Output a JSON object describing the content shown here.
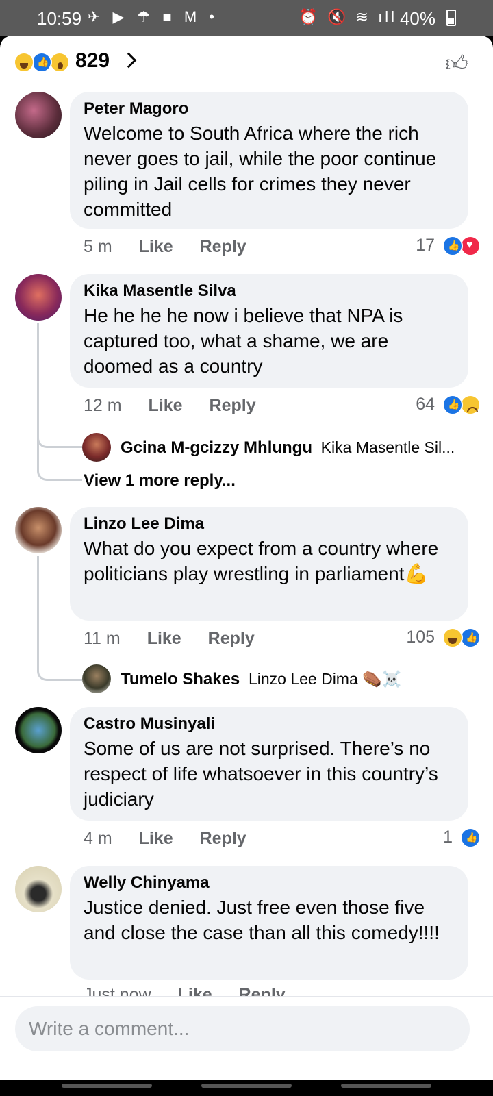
{
  "status_bar": {
    "time": "10:59",
    "left_icons": "✈ ▶ ☂ ■ M •",
    "right_icons": "⏰ 🔇 ≋ ıll",
    "battery": "40%"
  },
  "header": {
    "reaction_count": "829",
    "reactions": [
      "haha",
      "like",
      "wow"
    ],
    "like_icon": "thumbs-up-outline-icon"
  },
  "comments": [
    {
      "author": "Peter Magoro",
      "text": "Welcome to South Africa where the rich never goes to jail, while the poor continue piling in Jail cells for crimes they never committed",
      "time": "5 m",
      "like": "Like",
      "reply": "Reply",
      "reaction_count": "17",
      "reactions": [
        "like",
        "love"
      ]
    },
    {
      "author": "Kika Masentle Silva",
      "text": "He he he he now i believe that NPA is captured too, what a shame, we are doomed as a country",
      "time": "12 m",
      "like": "Like",
      "reply": "Reply",
      "reaction_count": "64",
      "reactions": [
        "like",
        "sad"
      ],
      "reply_preview": {
        "author": "Gcina M-gcizzy Mhlungu",
        "text": "Kika Masentle Sil..."
      },
      "view_more": "View 1 more reply..."
    },
    {
      "author": "Linzo Lee Dima",
      "text": "What do you expect from a country where politicians play wrestling in parliament💪",
      "time": "11 m",
      "like": "Like",
      "reply": "Reply",
      "reaction_count": "105",
      "reactions": [
        "haha",
        "like"
      ],
      "reply_preview": {
        "author": "Tumelo Shakes",
        "text": "Linzo Lee Dima ⚰️☠️"
      }
    },
    {
      "author": "Castro Musinyali",
      "text": "Some of us are not surprised. There’s no respect of life whatsoever in this country’s judiciary",
      "time": "4 m",
      "like": "Like",
      "reply": "Reply",
      "reaction_count": "1",
      "reactions": [
        "like"
      ]
    },
    {
      "author": "Welly Chinyama",
      "text": "Justice denied. Just free even those five and close the case than all this comedy!!!!",
      "time": "Just now",
      "like": "Like",
      "reply": "Reply"
    }
  ],
  "composer": {
    "placeholder": "Write a comment..."
  }
}
